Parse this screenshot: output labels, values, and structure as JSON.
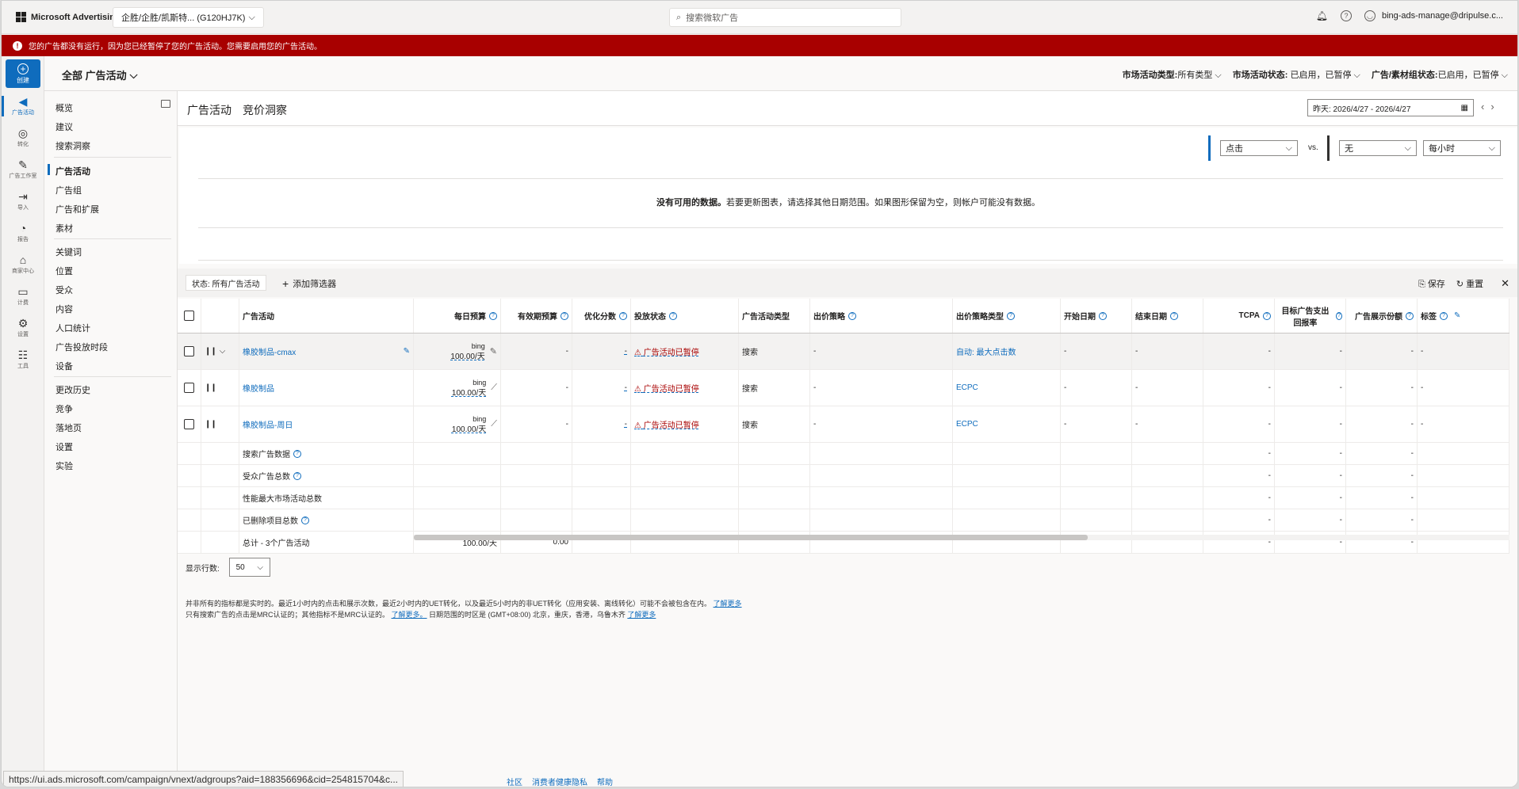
{
  "topbar": {
    "brand": "Microsoft Advertising",
    "account": "企胜/企胜/凯斯特... (G120HJ7K)",
    "search_placeholder": "搜索微软广告",
    "user": "bing-ads-manage@dripulse.c..."
  },
  "banner": {
    "text": "您的广告都没有运行，因为您已经暂停了您的广告活动。您需要启用您的广告活动。"
  },
  "rail": [
    {
      "label": "创建",
      "icon": "plus-icon"
    },
    {
      "label": "广告活动",
      "icon": "megaphone-icon"
    },
    {
      "label": "转化",
      "icon": "target-icon"
    },
    {
      "label": "广告工作室",
      "icon": "edit-icon"
    },
    {
      "label": "导入",
      "icon": "import-icon"
    },
    {
      "label": "报告",
      "icon": "report-icon"
    },
    {
      "label": "商家中心",
      "icon": "store-icon"
    },
    {
      "label": "计费",
      "icon": "billing-icon"
    },
    {
      "label": "设置",
      "icon": "gear-icon"
    },
    {
      "label": "工具",
      "icon": "tools-icon"
    }
  ],
  "scope": {
    "title": "全部 广告活动",
    "filter1_label": "市场活动类型:",
    "filter1_value": "所有类型",
    "filter2_label": "市场活动状态:",
    "filter2_value": "已启用，已暂停",
    "filter3_label": "广告/素材组状态:",
    "filter3_value": "已启用，已暂停"
  },
  "sidebar": {
    "group1": [
      "概览",
      "建议",
      "搜索洞察"
    ],
    "group2": [
      "广告活动",
      "广告组",
      "广告和扩展",
      "素材"
    ],
    "group3": [
      "关键词",
      "位置",
      "受众",
      "内容",
      "人口统计",
      "广告投放时段",
      "设备"
    ],
    "group4": [
      "更改历史",
      "竞争",
      "落地页",
      "设置",
      "实验"
    ]
  },
  "tabs": {
    "t1": "广告活动",
    "t2": "竞价洞察",
    "date": "昨天: 2026/4/27 - 2026/4/27"
  },
  "chart": {
    "metric1": "点击",
    "vs": "vs.",
    "metric2": "无",
    "interval": "每小时",
    "nodata_bold": "没有可用的数据。",
    "nodata_rest": "若要更新图表，请选择其他日期范围。如果图形保留为空，则帐户可能没有数据。"
  },
  "filterbar": {
    "status": "状态: 所有广告活动",
    "add": "添加筛选器",
    "save": "保存",
    "reset": "重置"
  },
  "table": {
    "headers": {
      "name": "广告活动",
      "budget": "每日预算",
      "eff_budget": "有效期预算",
      "opt": "优化分数",
      "delivery": "投放状态",
      "type": "广告活动类型",
      "bid": "出价策略",
      "bid_type": "出价策略类型",
      "start": "开始日期",
      "end": "结束日期",
      "tcpa": "TCPA",
      "roas": "目标广告支出回报率",
      "share": "广告展示份额",
      "labels": "标签"
    },
    "rows": [
      {
        "name": "橡胶制品-cmax",
        "budget_src": "bing",
        "budget": "100.00/天",
        "eff": "-",
        "opt": "-",
        "delivery": "广告活动已暂停",
        "type": "搜索",
        "bid": "-",
        "bid_type": "自动: 最大点击数",
        "start": "-",
        "end": "-",
        "tcpa": "-",
        "roas": "-",
        "share": "-",
        "labels": "-"
      },
      {
        "name": "橡胶制品",
        "budget_src": "bing",
        "budget": "100.00/天",
        "eff": "-",
        "opt": "-",
        "delivery": "广告活动已暂停",
        "type": "搜索",
        "bid": "-",
        "bid_type": "ECPC",
        "start": "-",
        "end": "-",
        "tcpa": "-",
        "roas": "-",
        "share": "-",
        "labels": "-"
      },
      {
        "name": "橡胶制品-周日",
        "budget_src": "bing",
        "budget": "100.00/天",
        "eff": "-",
        "opt": "-",
        "delivery": "广告活动已暂停",
        "type": "搜索",
        "bid": "-",
        "bid_type": "ECPC",
        "start": "-",
        "end": "-",
        "tcpa": "-",
        "roas": "-",
        "share": "-",
        "labels": "-"
      }
    ],
    "summary": [
      {
        "label": "搜索广告数据",
        "roas": "-",
        "share": "-",
        "tcpa": "-"
      },
      {
        "label": "受众广告总数",
        "roas": "-",
        "share": "-",
        "tcpa": "-"
      },
      {
        "label": "性能最大市场活动总数",
        "roas": "-",
        "share": "-",
        "tcpa": "-"
      },
      {
        "label": "已删除项目总数",
        "roas": "-",
        "share": "-",
        "tcpa": "-"
      },
      {
        "label": "总计 - 3个广告活动",
        "budget": "100.00/天",
        "eff": "0.00",
        "roas": "-",
        "share": "-",
        "tcpa": "-"
      }
    ]
  },
  "rows_label": "显示行数:",
  "rows_value": "50",
  "notes": {
    "line1": "并非所有的指标都是实时的。最近1小时内的点击和展示次数，最近2小时内的UET转化，以及最近5小时内的非UET转化（应用安装、离线转化）可能不会被包含在内。",
    "learn1": "了解更多",
    "line2a": "只有搜索广告的点击是MRC认证的；其他指标不是MRC认证的。",
    "learn2": "了解更多。",
    "line2b": "日期范围的时区是 (GMT+08:00) 北京，重庆，香港，乌鲁木齐",
    "learn3": "了解更多"
  },
  "status_url": "https://ui.ads.microsoft.com/campaign/vnext/adgroups?aid=188356696&cid=254815704&c...",
  "footer": [
    "社区",
    "消费者健康隐私",
    "帮助"
  ],
  "colors": {
    "accent": "#0f6cbd",
    "banner": "#a80000"
  }
}
